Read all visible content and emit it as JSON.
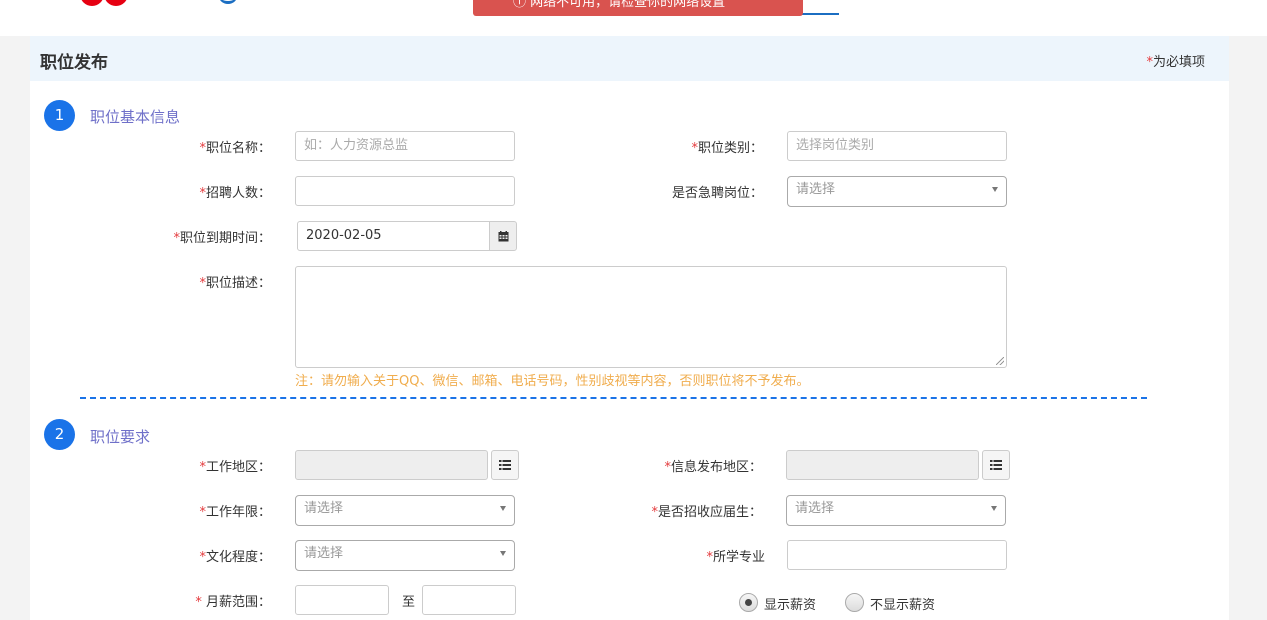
{
  "toast": {
    "icon": "info-circle-icon",
    "message": "ⓘ  网络不可用，请检查你的网络设置"
  },
  "page": {
    "title": "职位发布",
    "required_star": "*",
    "required_note": "为必填项"
  },
  "section1": {
    "number": "1",
    "title": "职位基本信息",
    "job_name": {
      "label": "职位名称：",
      "placeholder": "如：人力资源总监",
      "value": ""
    },
    "job_category": {
      "label": "职位类别：",
      "placeholder": "选择岗位类别",
      "value": ""
    },
    "headcount": {
      "label": "招聘人数：",
      "value": ""
    },
    "urgent": {
      "label": "是否急聘岗位：",
      "selected": "请选择"
    },
    "expire_date": {
      "label": "职位到期时间：",
      "value": "2020-02-05"
    },
    "description": {
      "label": "职位描述：",
      "value": ""
    },
    "notice": "注：请勿输入关于QQ、微信、邮箱、电话号码，性别歧视等内容，否则职位将不予发布。"
  },
  "section2": {
    "number": "2",
    "title": "职位要求",
    "work_area": {
      "label": "工作地区：",
      "value": ""
    },
    "publish_area": {
      "label": "信息发布地区：",
      "value": ""
    },
    "experience": {
      "label": "工作年限：",
      "selected": "请选择"
    },
    "fresh_grad": {
      "label": "是否招收应届生：",
      "selected": "请选择"
    },
    "education": {
      "label": "文化程度：",
      "selected": "请选择"
    },
    "major": {
      "label": "所学专业",
      "value": ""
    },
    "salary": {
      "label": " 月薪范围：",
      "separator": "至",
      "min": "",
      "max": ""
    },
    "salary_display": {
      "show_label": "显示薪资",
      "hide_label": "不显示薪资",
      "selected": "show"
    }
  },
  "colors": {
    "accent": "#1a73e8",
    "required": "#e4393c",
    "warning": "#f0ad4e",
    "section_title": "#6f70c9",
    "toast": "#d9534f"
  }
}
